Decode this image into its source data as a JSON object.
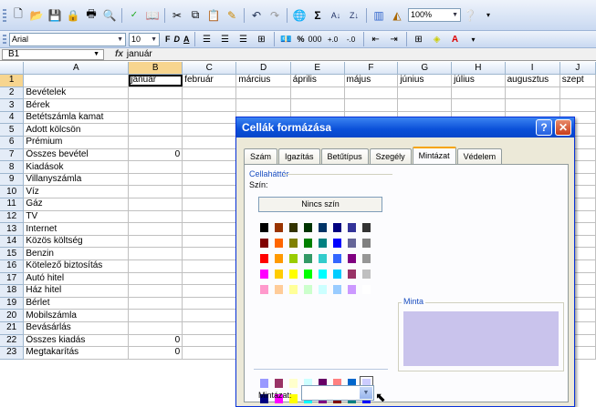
{
  "toolbar1": {
    "icons": [
      "new-icon",
      "open-icon",
      "save-icon",
      "permission-icon",
      "print-icon",
      "print-preview-icon",
      "spelling-icon",
      "research-icon",
      "cut-icon",
      "copy-icon",
      "paste-icon",
      "format-painter-icon",
      "undo-icon",
      "redo-icon",
      "hyperlink-icon",
      "autosum-icon",
      "sort-asc-icon",
      "sort-desc-icon",
      "chart-wizard-icon",
      "drawing-icon"
    ],
    "zoom": "100%"
  },
  "toolbar2": {
    "font": "Arial",
    "size": "10",
    "bold": "F",
    "italic": "D",
    "underline": "A",
    "percent": "%",
    "thousands": "000"
  },
  "formula_bar": {
    "name_box": "B1",
    "fx": "fx",
    "content": "január"
  },
  "columns": [
    "",
    "A",
    "B",
    "C",
    "D",
    "E",
    "F",
    "G",
    "H",
    "I",
    "J"
  ],
  "header_row": [
    "",
    "január",
    "február",
    "március",
    "április",
    "május",
    "június",
    "július",
    "augusztus",
    "szept"
  ],
  "rows": [
    {
      "n": "1",
      "a": "",
      "b": ""
    },
    {
      "n": "2",
      "a": "Bevételek",
      "b": ""
    },
    {
      "n": "3",
      "a": "Bérek",
      "b": ""
    },
    {
      "n": "4",
      "a": "Betétszámla kamat",
      "b": ""
    },
    {
      "n": "5",
      "a": "Adott kölcsön",
      "b": ""
    },
    {
      "n": "6",
      "a": "Prémium",
      "b": ""
    },
    {
      "n": "7",
      "a": "Összes bevétel",
      "b": "0"
    },
    {
      "n": "8",
      "a": "Kiadások",
      "b": ""
    },
    {
      "n": "9",
      "a": "Villanyszámla",
      "b": ""
    },
    {
      "n": "10",
      "a": "Víz",
      "b": ""
    },
    {
      "n": "11",
      "a": "Gáz",
      "b": ""
    },
    {
      "n": "12",
      "a": "TV",
      "b": ""
    },
    {
      "n": "13",
      "a": "Internet",
      "b": ""
    },
    {
      "n": "14",
      "a": "Közös költség",
      "b": ""
    },
    {
      "n": "15",
      "a": "Benzin",
      "b": ""
    },
    {
      "n": "16",
      "a": "Kötelező biztosítás",
      "b": ""
    },
    {
      "n": "17",
      "a": "Autó hitel",
      "b": ""
    },
    {
      "n": "18",
      "a": "Ház hitel",
      "b": ""
    },
    {
      "n": "19",
      "a": "Bérlet",
      "b": ""
    },
    {
      "n": "20",
      "a": "Mobilszámla",
      "b": ""
    },
    {
      "n": "21",
      "a": "Bevásárlás",
      "b": ""
    },
    {
      "n": "22",
      "a": "Összes kiadás",
      "b": "0"
    },
    {
      "n": "23",
      "a": "Megtakarítás",
      "b": "0"
    }
  ],
  "dialog": {
    "title": "Cellák formázása",
    "help": "?",
    "close": "✕",
    "tabs": [
      "Szám",
      "Igazítás",
      "Betűtípus",
      "Szegély",
      "Mintázat",
      "Védelem"
    ],
    "active_tab": "Mintázat",
    "section_label": "Cellaháttér",
    "color_label": "Szín:",
    "no_color": "Nincs szín",
    "palette": [
      "#000000",
      "#993300",
      "#333300",
      "#003300",
      "#003366",
      "#000080",
      "#333399",
      "#333333",
      "#800000",
      "#ff6600",
      "#808000",
      "#008000",
      "#008080",
      "#0000ff",
      "#666699",
      "#808080",
      "#ff0000",
      "#ff9900",
      "#99cc00",
      "#339966",
      "#33cccc",
      "#3366ff",
      "#800080",
      "#969696",
      "#ff00ff",
      "#ffcc00",
      "#ffff00",
      "#00ff00",
      "#00ffff",
      "#00ccff",
      "#993366",
      "#c0c0c0",
      "#ff99cc",
      "#ffcc99",
      "#ffff99",
      "#ccffcc",
      "#ccffff",
      "#99ccff",
      "#cc99ff",
      "#ffffff"
    ],
    "palette_extra": [
      "#9999ff",
      "#993366",
      "#ffffcc",
      "#ccffff",
      "#660066",
      "#ff8080",
      "#0066cc",
      "#ccccff",
      "#000080",
      "#ff00ff",
      "#ffff00",
      "#00ffff",
      "#800080",
      "#800000",
      "#008080",
      "#0000ff"
    ],
    "preview_label": "Minta",
    "preview_color": "#c9c3ec",
    "pattern_label": "Mintázat:",
    "pattern_value": ""
  }
}
